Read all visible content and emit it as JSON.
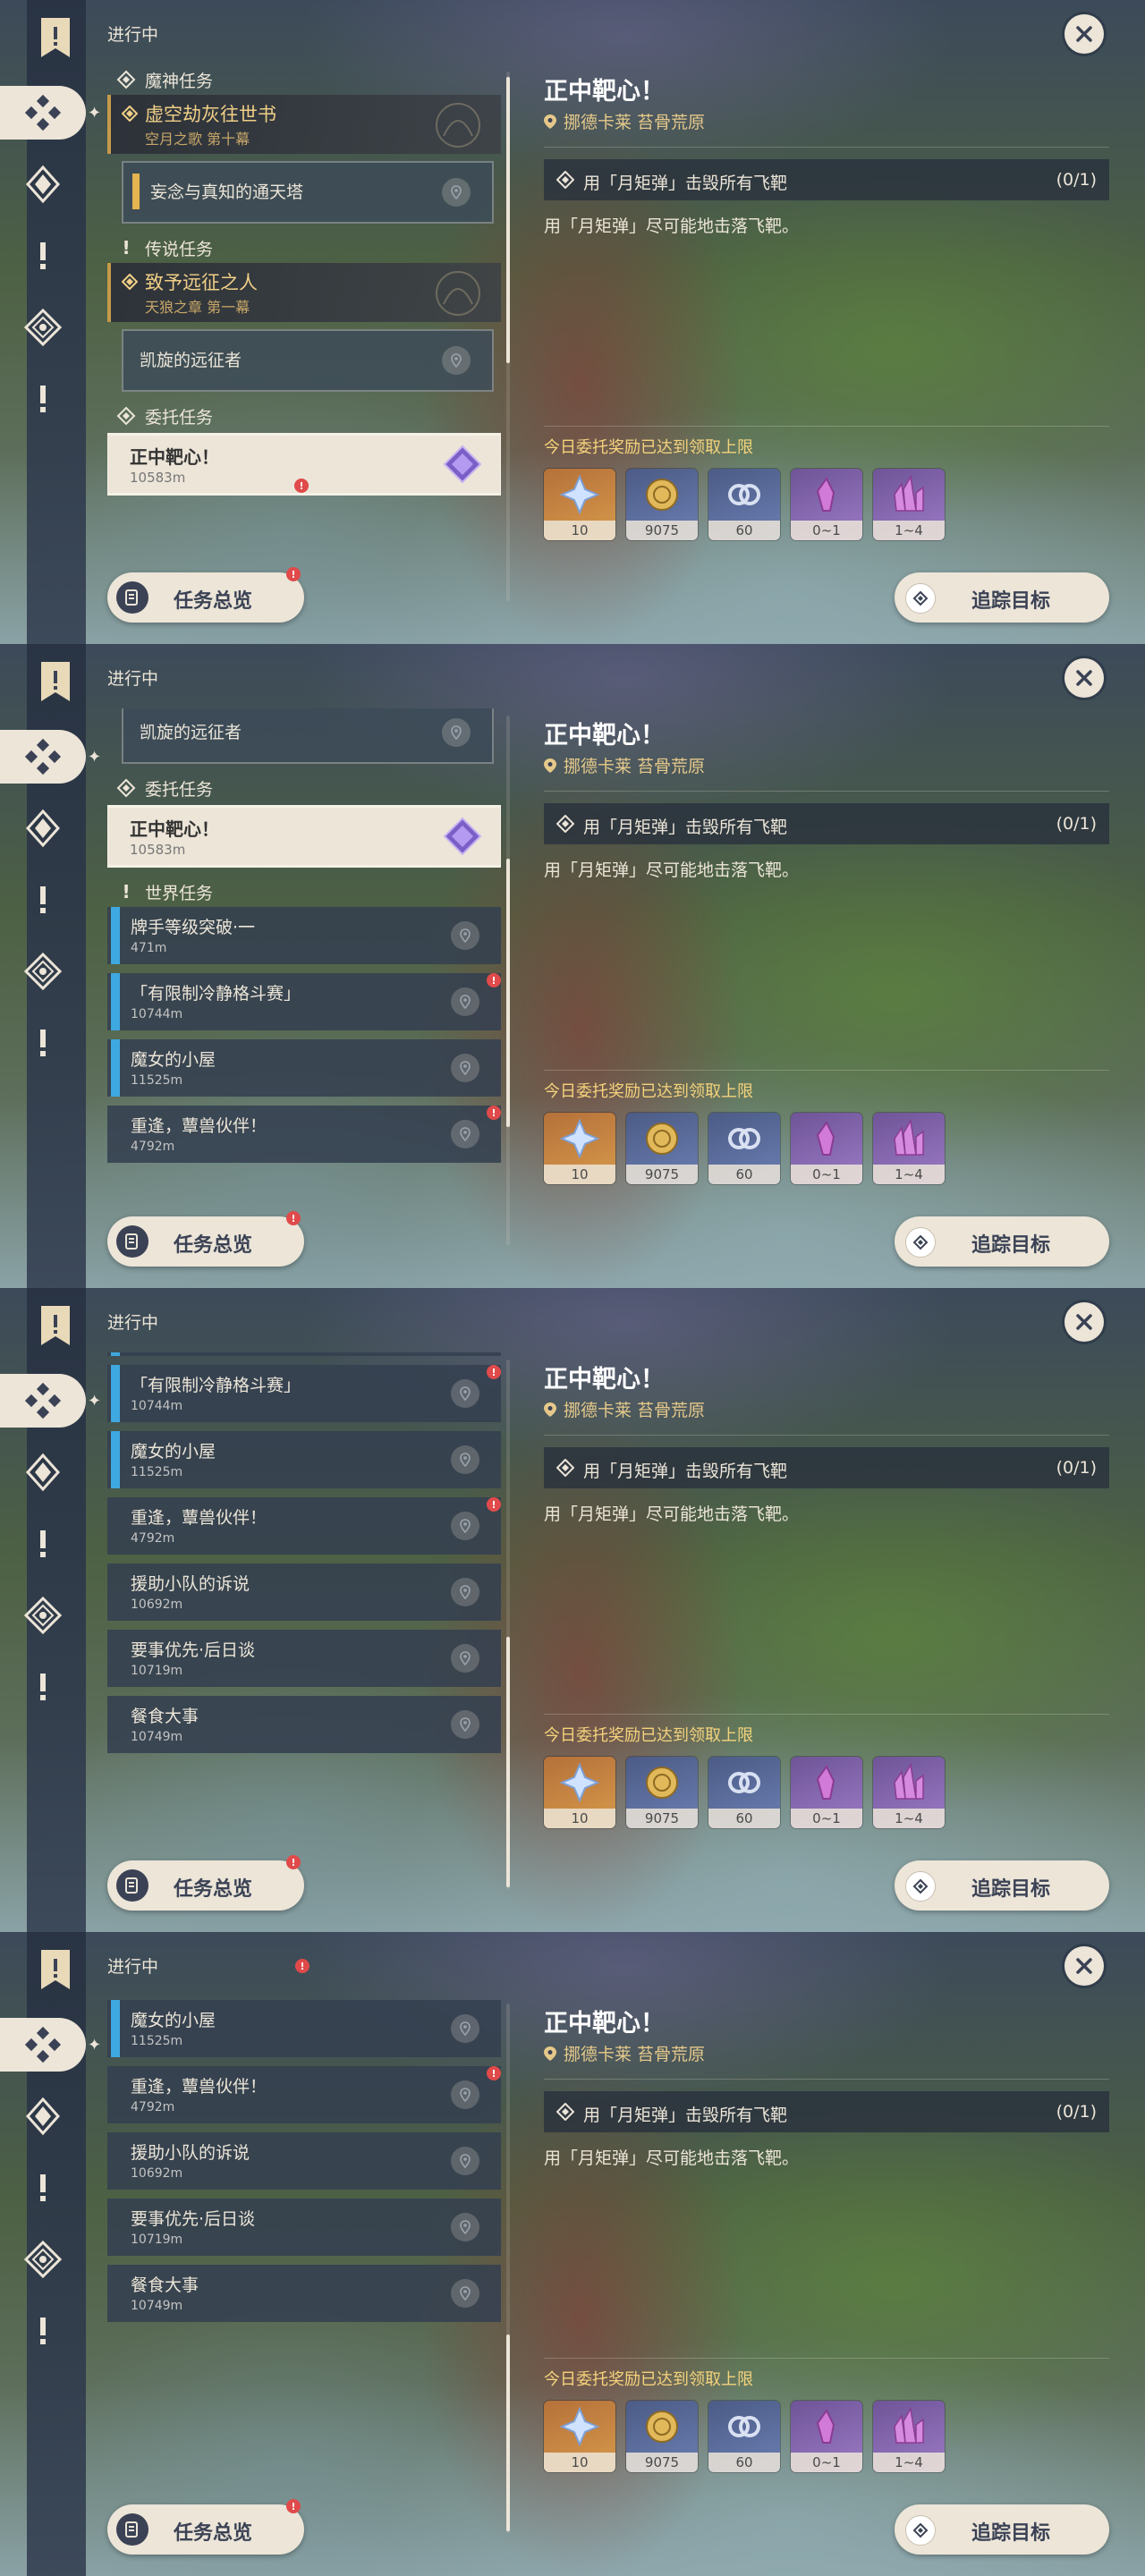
{
  "header": {
    "title": "进行中",
    "close_label": "关闭"
  },
  "groups": {
    "archon": "魔神任务",
    "legend": "传说任务",
    "commission": "委托任务",
    "world": "世界任务"
  },
  "archon_quest": {
    "title": "虚空劫灰往世书",
    "subtitle": "空月之歌 第十幕",
    "step": "妄念与真知的通天塔"
  },
  "legend_quest": {
    "title": "致予远征之人",
    "subtitle": "天狼之章 第一幕",
    "step": "凯旋的远征者"
  },
  "commission_quest": {
    "title": "正中靶心！",
    "distance": "10583m"
  },
  "world_quests": [
    {
      "title": "牌手等级突破·一",
      "distance": "471m"
    },
    {
      "title": "「有限制冷静格斗赛」",
      "distance": "10744m"
    },
    {
      "title": "魔女的小屋",
      "distance": "11525m"
    },
    {
      "title": "重逢，蕈兽伙伴！",
      "distance": "4792m"
    },
    {
      "title": "援助小队的诉说",
      "distance": "10692m"
    },
    {
      "title": "要事优先·后日谈",
      "distance": "10719m"
    },
    {
      "title": "餐食大事",
      "distance": "10749m"
    }
  ],
  "detail": {
    "title": "正中靶心！",
    "location": "挪德卡莱 苔骨荒原",
    "objective": "用「月矩弹」击毁所有飞靶",
    "count": "(0/1)",
    "description": "用「月矩弹」尽可能地击落飞靶。",
    "reward_notice": "今日委托奖励已达到领取上限",
    "rewards": [
      {
        "icon": "primogem-icon",
        "qty": "10",
        "bg": "orange"
      },
      {
        "icon": "mora-icon",
        "qty": "9075",
        "bg": "blue"
      },
      {
        "icon": "companionship-icon",
        "qty": "60",
        "bg": "blue"
      },
      {
        "icon": "crystal-icon",
        "qty": "0~1",
        "bg": "purple"
      },
      {
        "icon": "crystal-cluster-icon",
        "qty": "1~4",
        "bg": "purple"
      }
    ]
  },
  "buttons": {
    "overview": "任务总览",
    "track": "追踪目标"
  },
  "colors": {
    "accent": "#ece5d8",
    "archon_gold": "#f0cf86",
    "world_blue": "#3fa8e0",
    "alert_red": "#e04a4a",
    "reward_notice": "#f5d37c"
  }
}
